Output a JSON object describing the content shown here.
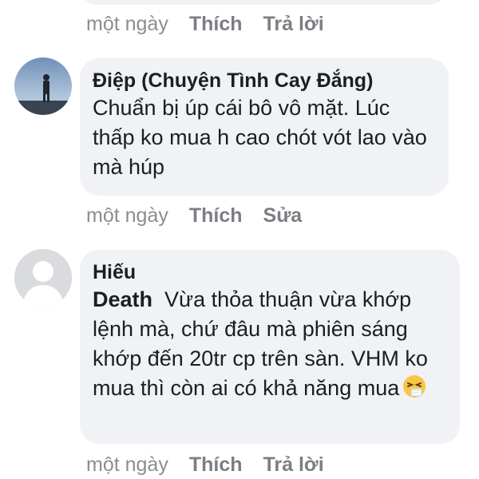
{
  "comments": [
    {
      "time": "một ngày",
      "actions": [
        "Thích",
        "Trả lời"
      ]
    },
    {
      "author": "Điệp (Chuyện Tình Cay Đắng)",
      "text": "Chuẩn bị úp cái bô vô mặt. Lúc thấp ko mua h cao chót vót lao vào mà húp",
      "time": "một ngày",
      "actions": [
        "Thích",
        "Sửa"
      ],
      "avatar_icon": "photo-person-avatar"
    },
    {
      "author": "Hiếu",
      "mention": "Death",
      "text": "Vừa thỏa thuận vừa khớp lệnh mà, chứ đâu mà phiên sáng khớp đến 20tr cp trên sàn. VHM ko mua thì còn ai có khả năng mua",
      "emoji": "sneezing-face-emoji",
      "time": "một ngày",
      "actions": [
        "Thích",
        "Trả lời"
      ],
      "avatar_icon": "default-person-avatar"
    }
  ],
  "colors": {
    "bubble": "#f0f2f5",
    "meta_text": "#8a8d91"
  }
}
